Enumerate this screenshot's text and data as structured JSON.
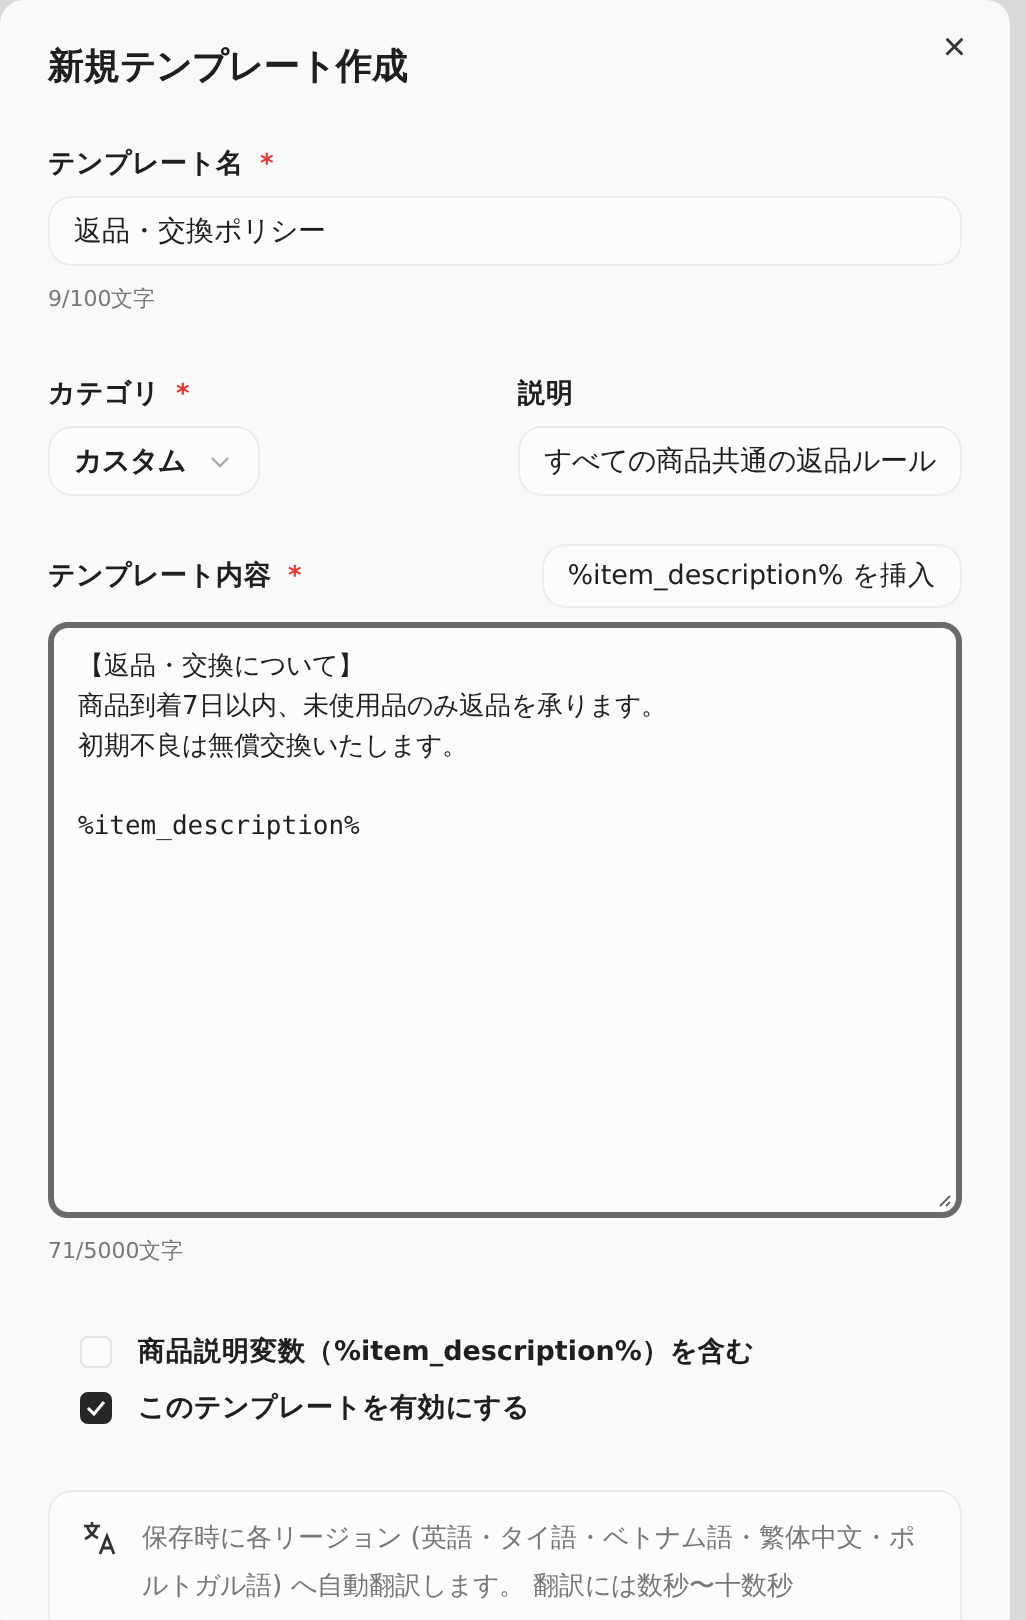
{
  "dialog": {
    "title": "新規テンプレート作成",
    "close": "×"
  },
  "name_field": {
    "label": "テンプレート名",
    "required": "*",
    "value": "返品・交換ポリシー",
    "counter": "9/100文字"
  },
  "category_field": {
    "label": "カテゴリ",
    "required": "*",
    "value": "カスタム"
  },
  "description_field": {
    "label": "説明",
    "value": "すべての商品共通の返品ルール"
  },
  "content_field": {
    "label": "テンプレート内容",
    "required": "*",
    "insert_button": "%item_description% を挿入",
    "counter": "71/5000文字",
    "lines": [
      {
        "kind": "text",
        "text": "【返品・交換について】"
      },
      {
        "kind": "text",
        "text": "商品到着7日以内、未使用品のみ返品を承ります。"
      },
      {
        "kind": "text",
        "text": "初期不良は無償交換いたします。"
      },
      {
        "kind": "blank"
      },
      {
        "kind": "variable",
        "text": "%item_description%"
      }
    ]
  },
  "options": [
    {
      "label": "商品説明変数（%item_description%）を含む",
      "checked": false
    },
    {
      "label": "このテンプレートを有効にする",
      "checked": true
    }
  ],
  "notice": {
    "text": "保存時に各リージョン (英語・タイ語・ベトナム語・繁体中文・ポルトガル語) へ自動翻訳します。 翻訳には数秒〜十数秒"
  }
}
